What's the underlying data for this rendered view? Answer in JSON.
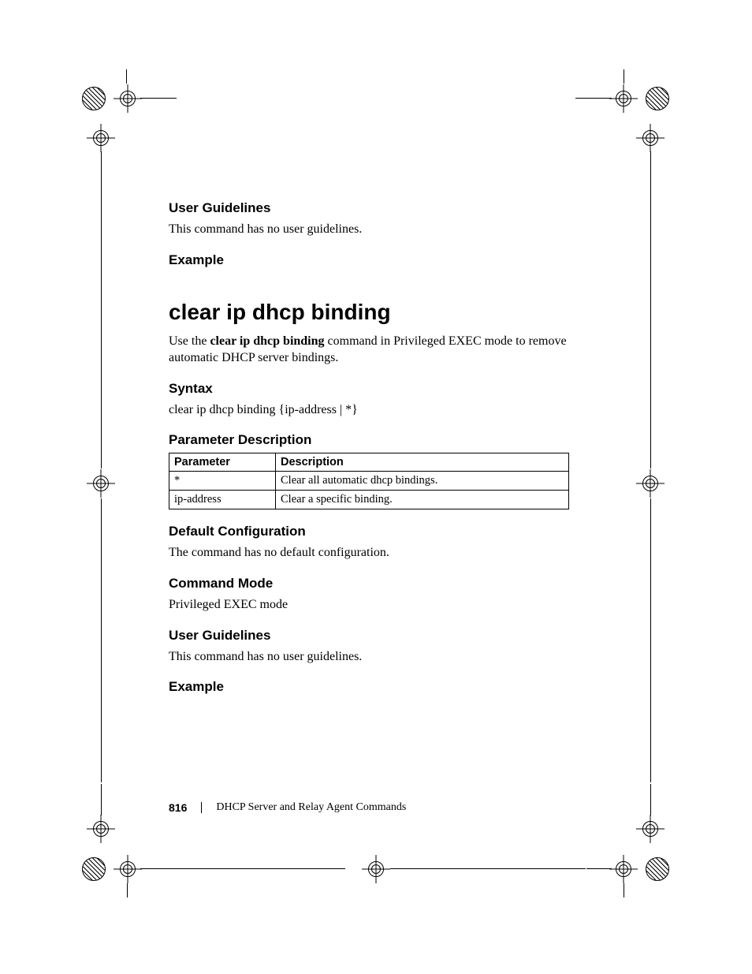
{
  "sections": {
    "ug1": {
      "heading": "User Guidelines",
      "text": "This command has no user guidelines."
    },
    "ex1": {
      "heading": "Example"
    },
    "cmd": {
      "title": "clear ip dhcp binding",
      "desc_pre": "Use the ",
      "desc_bold": "clear ip dhcp binding",
      "desc_post": " command in Privileged EXEC mode to remove automatic DHCP server bindings."
    },
    "syntax": {
      "heading": "Syntax",
      "text": "clear ip dhcp binding {ip-address | *}"
    },
    "paramdesc": {
      "heading": "Parameter Description",
      "cols": {
        "p": "Parameter",
        "d": "Description"
      },
      "rows": [
        {
          "p": "*",
          "d": "Clear all automatic dhcp bindings."
        },
        {
          "p": "ip-address",
          "d": "Clear a specific binding."
        }
      ]
    },
    "defcfg": {
      "heading": "Default Configuration",
      "text": "The command has no default configuration."
    },
    "cmdmode": {
      "heading": "Command Mode",
      "text": "Privileged EXEC mode"
    },
    "ug2": {
      "heading": "User Guidelines",
      "text": "This command has no user guidelines."
    },
    "ex2": {
      "heading": "Example"
    }
  },
  "footer": {
    "page": "816",
    "title": "DHCP Server and Relay Agent Commands"
  }
}
